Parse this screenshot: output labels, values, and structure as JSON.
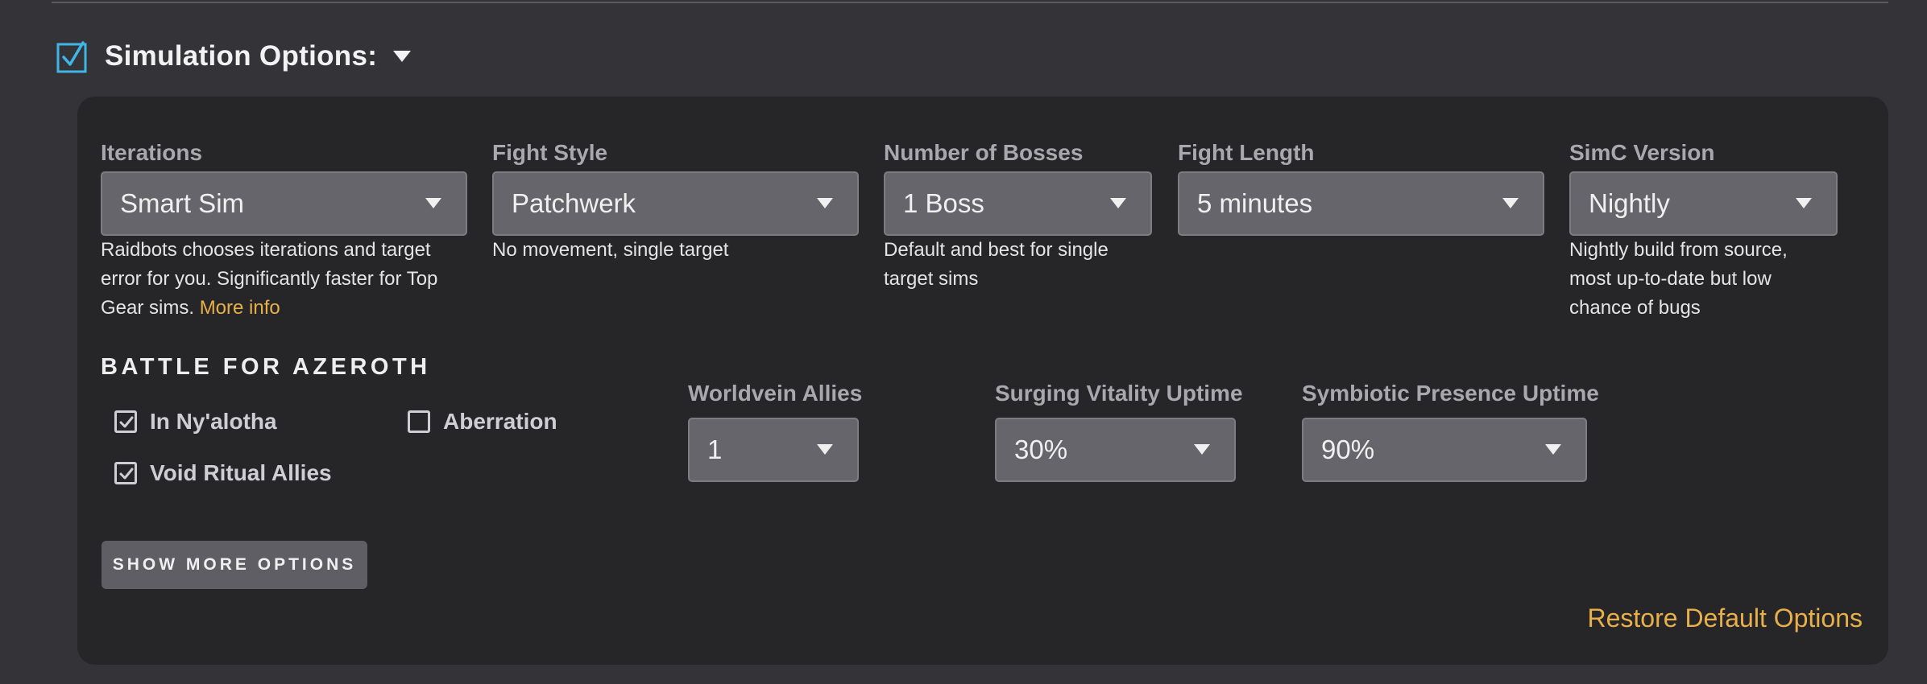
{
  "section": {
    "title": "Simulation Options:",
    "enabled": true,
    "accent": "#3fb6e6"
  },
  "fields": {
    "iterations": {
      "label": "Iterations",
      "value": "Smart Sim",
      "desc": "Raidbots chooses iterations and target error for you. Significantly faster for Top Gear sims.",
      "link": "More info"
    },
    "fight_style": {
      "label": "Fight Style",
      "value": "Patchwerk",
      "desc": "No movement, single target"
    },
    "bosses": {
      "label": "Number of Bosses",
      "value": "1 Boss",
      "desc": "Default and best for single target sims"
    },
    "fight_length": {
      "label": "Fight Length",
      "value": "5 minutes"
    },
    "simc_version": {
      "label": "SimC Version",
      "value": "Nightly",
      "desc": "Nightly build from source, most up-to-date but low chance of bugs"
    }
  },
  "bfa": {
    "title": "BATTLE FOR AZEROTH",
    "checks": [
      {
        "label": "In Ny'alotha",
        "checked": true
      },
      {
        "label": "Aberration",
        "checked": false
      },
      {
        "label": "Void Ritual Allies",
        "checked": true
      }
    ],
    "worldvein": {
      "label": "Worldvein Allies",
      "value": "1"
    },
    "surging": {
      "label": "Surging Vitality Uptime",
      "value": "30%"
    },
    "symbiotic": {
      "label": "Symbiotic Presence Uptime",
      "value": "90%"
    }
  },
  "actions": {
    "more": "SHOW MORE OPTIONS",
    "restore": "Restore Default Options"
  },
  "colors": {
    "link": "#e9b04a",
    "panel": "#262628",
    "background": "#333338"
  }
}
